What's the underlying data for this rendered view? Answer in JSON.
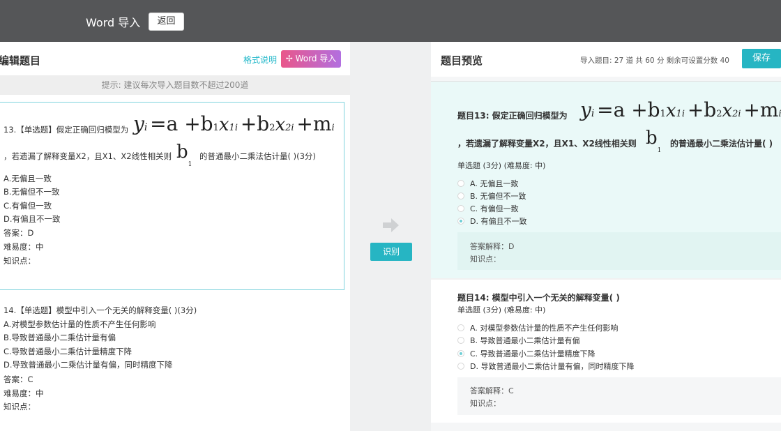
{
  "topbar": {
    "title": "Word 导入",
    "back_label": "返回"
  },
  "editor": {
    "title": "编辑题目",
    "format_link": "格式说明",
    "word_import_label": "Word 导入",
    "hint": "提示: 建议每次导入题目数不超过200道",
    "q13": {
      "line1_prefix": "13.【单选题】假定正确回归模型为",
      "line2_a": "，若遗漏了解释变量X2，且X1、X2线性相关则",
      "line2_b": "的普通最小二乘法估计量( )(3分)",
      "options": [
        "A.无偏且一致",
        "B.无偏但不一致",
        "C.有偏但一致",
        "D.有偏且不一致"
      ],
      "answer": "答案：D",
      "difficulty": "难易度：中",
      "knowledge": "知识点："
    },
    "q14": {
      "line1": "14.【单选题】模型中引入一个无关的解释变量( )(3分)",
      "options": [
        "A.对模型参数估计量的性质不产生任何影响",
        "B.导致普通最小二乘估计量有偏",
        "C.导致普通最小二乘估计量精度下降",
        "D.导致普通最小二乘估计量有偏，同时精度下降"
      ],
      "answer": "答案：C",
      "difficulty": "难易度：中",
      "knowledge": "知识点："
    }
  },
  "middle": {
    "recognize_label": "识别"
  },
  "preview": {
    "title": "题目预览",
    "info": "导入题目: 27 道 共 60 分 剩余可设置分数 40",
    "save_label": "保存",
    "q13": {
      "title_prefix": "题目13:  假定正确回归模型为",
      "line2_a": "，若遗漏了解释变量X2，且X1、X2线性相关则",
      "line2_b": "的普通最小二乘法估计量( )",
      "meta": "单选题 (3分) (难易度: 中)",
      "options": [
        "A. 无偏且一致",
        "B. 无偏但不一致",
        "C. 有偏但一致",
        "D. 有偏且不一致"
      ],
      "selected": 3,
      "explanation": "答案解释：D",
      "knowledge": "知识点："
    },
    "q14": {
      "title": "题目14:  模型中引入一个无关的解释变量( )",
      "meta": "单选题 (3分) (难易度: 中)",
      "options": [
        "A. 对模型参数估计量的性质不产生任何影响",
        "B. 导致普通最小二乘估计量有偏",
        "C. 导致普通最小二乘估计量精度下降",
        "D. 导致普通最小二乘估计量有偏，同时精度下降"
      ],
      "selected": 2,
      "explanation": "答案解释：C",
      "knowledge": "知识点："
    }
  },
  "formula": {
    "y": "y",
    "y_sub": "i",
    "eq": "=a +b",
    "b1": "1",
    "x1": "x",
    "x1_sub": "1i",
    "plus2": "+b",
    "b2": "2",
    "x2": "x",
    "x2_sub": "2i",
    "plus3": "+",
    "m": "m",
    "m_sub": "i",
    "b_big": "b",
    "b_big_sub": "1"
  },
  "colors": {
    "accent": "#26b5c3",
    "topbar": "#555658",
    "word_gradient_start": "#e9568a",
    "word_gradient_end": "#b26fe0"
  }
}
